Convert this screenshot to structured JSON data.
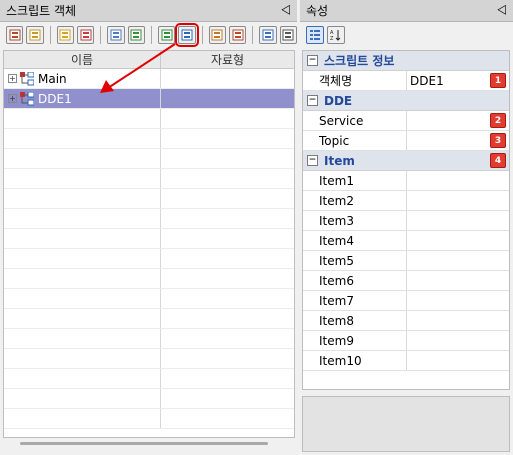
{
  "left_panel": {
    "title": "스크립트 객체",
    "pin": "⨞",
    "toolbar": [
      {
        "name": "tb-insert-icon",
        "color": "#b24a2f"
      },
      {
        "name": "tb-find-icon",
        "color": "#c89a2a"
      },
      {
        "name": "tb-db-icon",
        "color": "#d6a322"
      },
      {
        "name": "tb-chart-icon",
        "color": "#c43c3c"
      },
      {
        "name": "tb-table-icon",
        "color": "#4a7cc1"
      },
      {
        "name": "tb-import-icon",
        "color": "#3d8f3d"
      },
      {
        "name": "tb-excel-icon",
        "color": "#2f8f3a"
      },
      {
        "name": "tb-dde-icon",
        "color": "#2b66b7"
      },
      {
        "name": "tb-grid-icon",
        "color": "#c0782e"
      },
      {
        "name": "tb-export-icon",
        "color": "#b74b2b"
      },
      {
        "name": "tb-window-icon",
        "color": "#3a6fb8"
      },
      {
        "name": "tb-close-window-icon",
        "color": "#555555"
      }
    ],
    "columns": {
      "name": "이름",
      "type": "자료형"
    },
    "tree_items": [
      {
        "label": "Main",
        "selected": false
      },
      {
        "label": "DDE1",
        "selected": true
      }
    ],
    "empty_rows": 16
  },
  "right_panel": {
    "title": "속성",
    "pin": "⨞",
    "categories": [
      {
        "label": "스크립트 정보",
        "badge": "",
        "rows": [
          {
            "name": "객체명",
            "value": "DDE1",
            "badge": "1"
          }
        ]
      },
      {
        "label": "DDE",
        "badge": "",
        "rows": [
          {
            "name": "Service",
            "value": "",
            "badge": "2"
          },
          {
            "name": "Topic",
            "value": "",
            "badge": "3"
          }
        ]
      },
      {
        "label": "Item",
        "badge": "4",
        "rows": [
          {
            "name": "Item1",
            "value": "",
            "badge": ""
          },
          {
            "name": "Item2",
            "value": "",
            "badge": ""
          },
          {
            "name": "Item3",
            "value": "",
            "badge": ""
          },
          {
            "name": "Item4",
            "value": "",
            "badge": ""
          },
          {
            "name": "Item5",
            "value": "",
            "badge": ""
          },
          {
            "name": "Item6",
            "value": "",
            "badge": ""
          },
          {
            "name": "Item7",
            "value": "",
            "badge": ""
          },
          {
            "name": "Item8",
            "value": "",
            "badge": ""
          },
          {
            "name": "Item9",
            "value": "",
            "badge": ""
          },
          {
            "name": "Item10",
            "value": "",
            "badge": ""
          }
        ]
      }
    ]
  },
  "colors": {
    "selection": "#9090cc",
    "annotation": "#e10000",
    "badge": "#e23b2f",
    "category_text": "#23499b"
  }
}
